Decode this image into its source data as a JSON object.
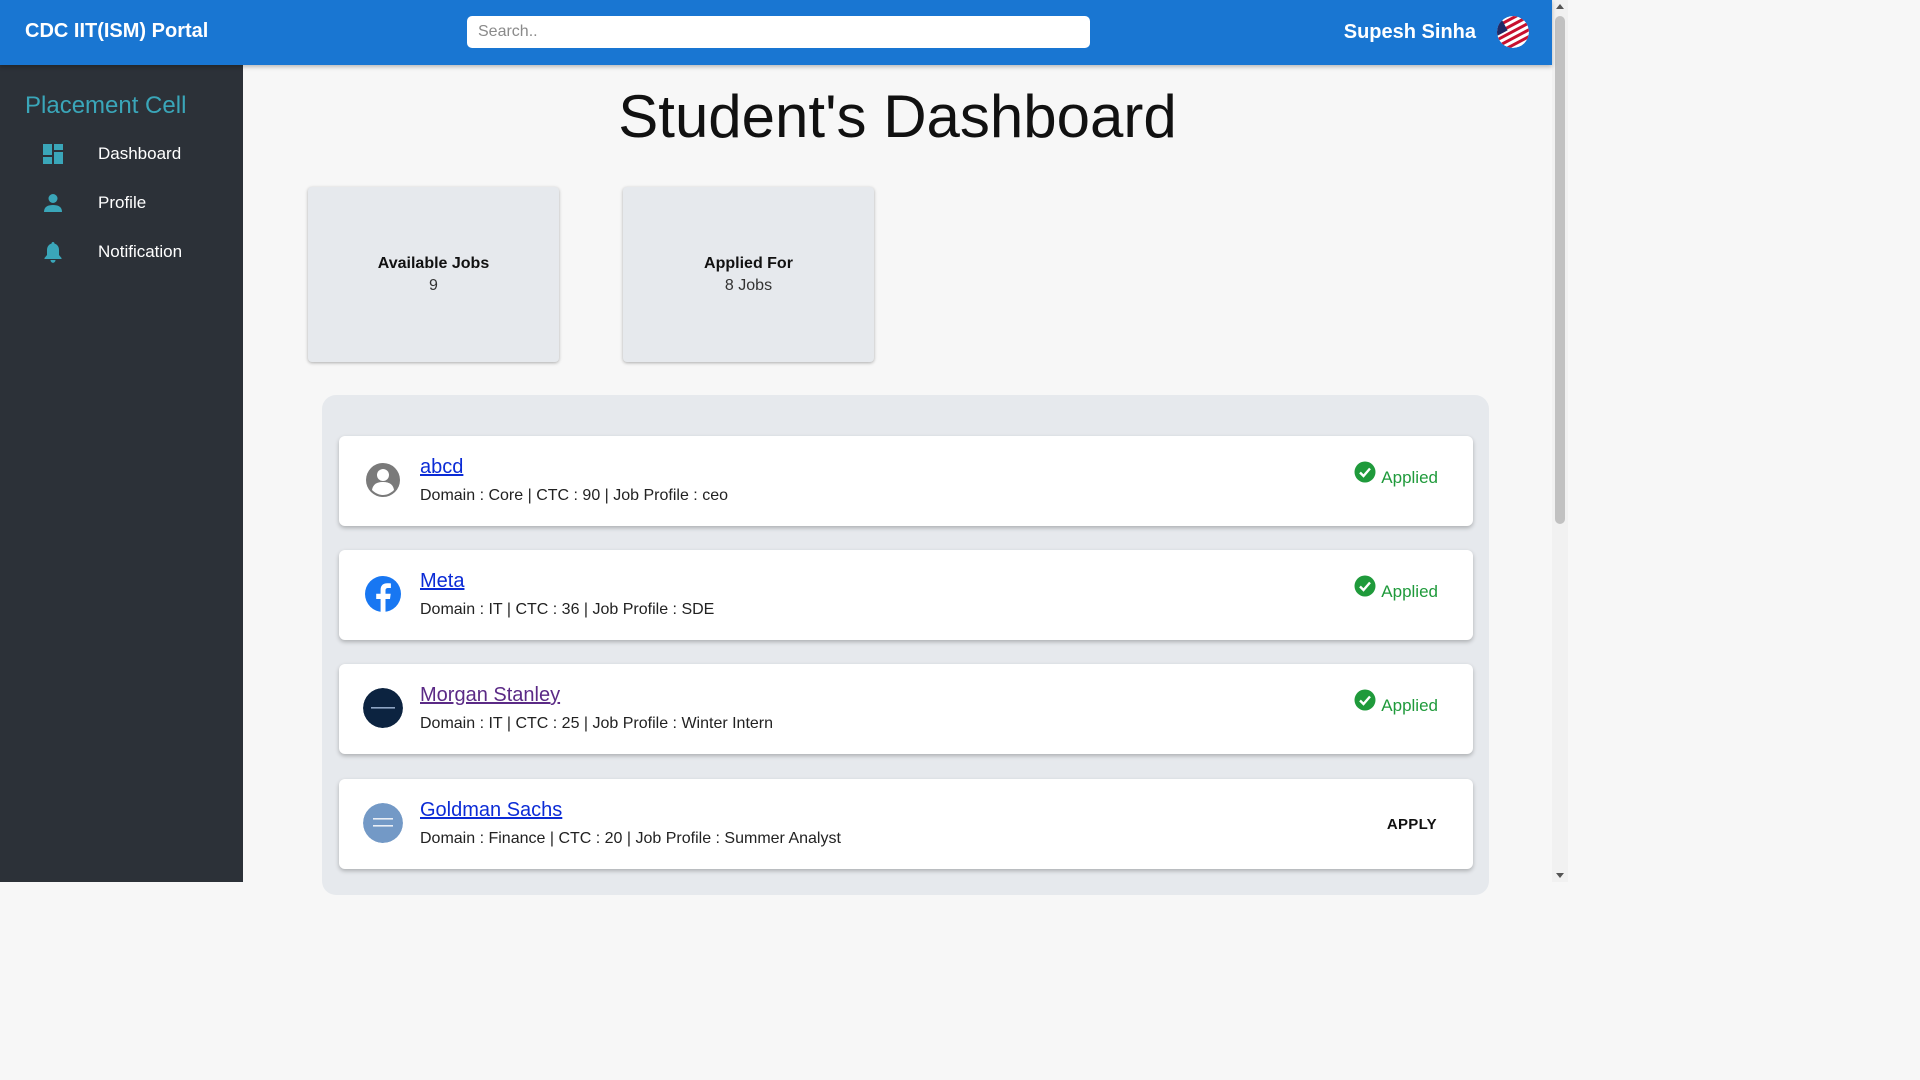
{
  "header": {
    "brand": "CDC IIT(ISM) Portal",
    "search_placeholder": "Search..",
    "user_name": "Supesh Sinha"
  },
  "sidebar": {
    "title": "Placement Cell",
    "items": [
      {
        "label": "Dashboard",
        "icon": "dashboard-icon"
      },
      {
        "label": "Profile",
        "icon": "person-icon"
      },
      {
        "label": "Notification",
        "icon": "bell-icon"
      }
    ]
  },
  "main": {
    "title": "Student's Dashboard",
    "stats": [
      {
        "label": "Available Jobs",
        "value": "9"
      },
      {
        "label": "Applied For",
        "value": "8 Jobs"
      }
    ],
    "jobs": [
      {
        "company": "abcd",
        "details": "Domain : Core | CTC : 90 | Job Profile : ceo",
        "status": "Applied",
        "logo": "default-avatar-icon"
      },
      {
        "company": "Meta",
        "details": "Domain : IT | CTC : 36 | Job Profile : SDE",
        "status": "Applied",
        "logo": "facebook-logo"
      },
      {
        "company": "Morgan Stanley",
        "details": "Domain : IT | CTC : 25 | Job Profile : Winter Intern",
        "status": "Applied",
        "logo": "morgan-stanley-logo"
      },
      {
        "company": "Goldman Sachs",
        "details": "Domain : Finance | CTC : 20 | Job Profile : Summer Analyst",
        "action": "APPLY",
        "logo": "goldman-sachs-logo"
      }
    ]
  },
  "colors": {
    "topbar": "#1976d2",
    "sidebar": "#2c3138",
    "accent": "#3aa6b9",
    "applied": "#1f9a3b",
    "link": "#0b2bd6"
  }
}
